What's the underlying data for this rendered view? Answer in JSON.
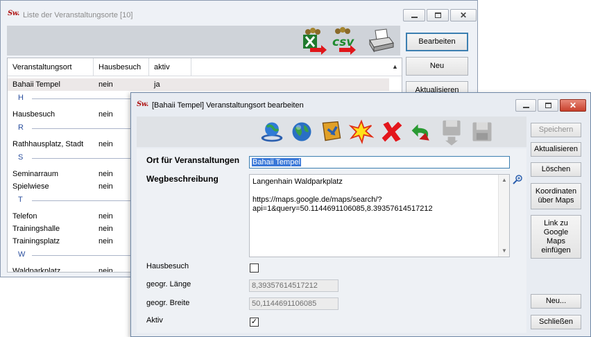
{
  "list_window": {
    "title": "Liste der Veranstaltungsorte [10]",
    "columns": [
      "Veranstaltungsort",
      "Hausbesuch",
      "aktiv"
    ],
    "rows": [
      {
        "name": "Bahaii Tempel",
        "hausbesuch": "nein",
        "aktiv": "ja"
      },
      {
        "group": "H"
      },
      {
        "name": "Hausbesuch",
        "hausbesuch": "nein",
        "aktiv": ""
      },
      {
        "group": "R"
      },
      {
        "name": "Rathhausplatz, Stadt",
        "hausbesuch": "nein",
        "aktiv": ""
      },
      {
        "group": "S"
      },
      {
        "name": "Seminarraum",
        "hausbesuch": "nein",
        "aktiv": ""
      },
      {
        "name": "Spielwiese",
        "hausbesuch": "nein",
        "aktiv": ""
      },
      {
        "group": "T"
      },
      {
        "name": "Telefon",
        "hausbesuch": "nein",
        "aktiv": ""
      },
      {
        "name": "Trainingshalle",
        "hausbesuch": "nein",
        "aktiv": ""
      },
      {
        "name": "Trainingsplatz",
        "hausbesuch": "nein",
        "aktiv": ""
      },
      {
        "group": "W"
      },
      {
        "name": "Waldparkplatz",
        "hausbesuch": "nein",
        "aktiv": ""
      }
    ],
    "buttons": {
      "edit": "Bearbeiten",
      "new": "Neu",
      "refresh": "Aktualisieren"
    },
    "toolbar_icons": [
      "excel-export-icon",
      "csv-export-icon",
      "printer-icon"
    ],
    "csv_text": "csv"
  },
  "edit_window": {
    "title": "[Bahaii Tempel] Veranstaltungsort bearbeiten",
    "labels": {
      "ort": "Ort für Veranstaltungen",
      "weg": "Wegbeschreibung",
      "hausbesuch": "Hausbesuch",
      "laenge": "geogr. Länge",
      "breite": "geogr. Breite",
      "aktiv": "Aktiv"
    },
    "values": {
      "ort": "Bahaii Tempel",
      "weg_line1": "Langenhain Waldparkplatz",
      "weg_line2": "https://maps.google.de/maps/search/?",
      "weg_line3": "api=1&query=50.1144691106085,8.39357614517212",
      "laenge": "8,39357614517212",
      "breite": "50,1144691106085",
      "hausbesuch_checked": false,
      "aktiv_checked": true
    },
    "buttons": {
      "save": "Speichern",
      "refresh": "Aktualisieren",
      "delete": "Löschen",
      "coords_1": "Koordinaten",
      "coords_2": "über Maps",
      "link_1": "Link zu",
      "link_2": "Google",
      "link_3": "Maps",
      "link_4": "einfügen",
      "new": "Neu...",
      "close": "Schließen"
    },
    "toolbar_icons": [
      "map-globe-icon",
      "globe-icon",
      "note-download-icon",
      "new-star-icon",
      "delete-x-icon",
      "undo-arrow-icon",
      "save-disabled-icon",
      "save-icon"
    ]
  },
  "app_icon_text": "Sw."
}
